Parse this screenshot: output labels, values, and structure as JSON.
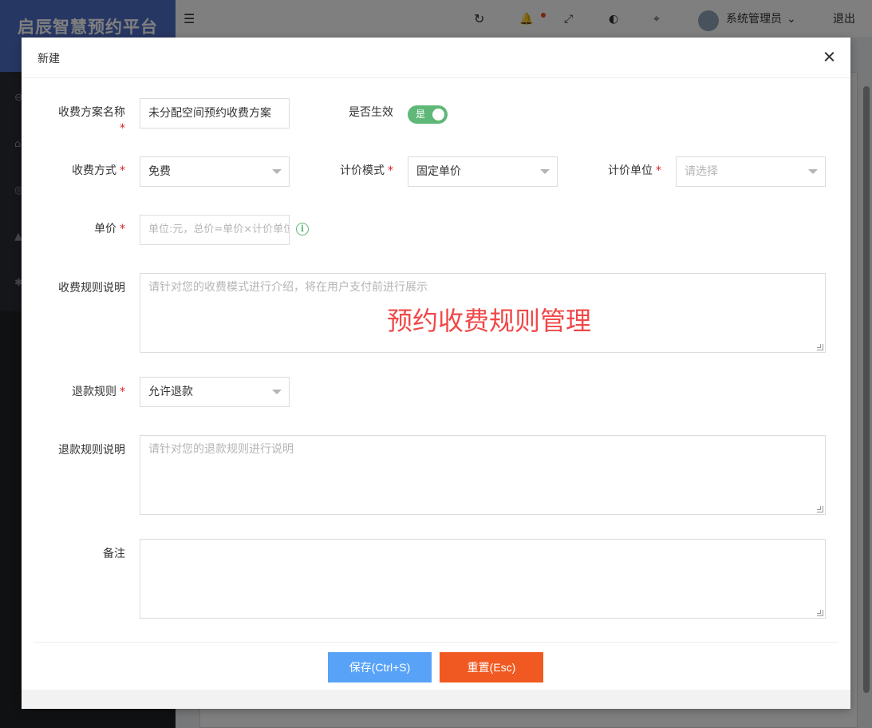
{
  "app": {
    "brand": "启辰智慧预约平台",
    "user_name": "系统管理员",
    "logout_label": "退出"
  },
  "modal": {
    "title": "新建",
    "fields": {
      "plan_name": {
        "label": "收费方案名称",
        "required_mark": "*",
        "value": "未分配空间预约收费方案"
      },
      "effective": {
        "label": "是否生效",
        "switch_text": "是"
      },
      "charge_method": {
        "label": "收费方式",
        "required_mark": "*",
        "value": "免费"
      },
      "pricing_mode": {
        "label": "计价模式",
        "required_mark": "*",
        "value": "固定单价"
      },
      "pricing_unit": {
        "label": "计价单位",
        "required_mark": "*",
        "placeholder": "请选择"
      },
      "unit_price": {
        "label": "单价",
        "required_mark": "*",
        "placeholder": "单位:元，总价=单价×计价单位"
      },
      "charge_rules": {
        "label": "收费规则说明",
        "placeholder": "请针对您的收费模式进行介绍，将在用户支付前进行展示"
      },
      "refund_rule": {
        "label": "退款规则",
        "required_mark": "*",
        "value": "允许退款"
      },
      "refund_rules_desc": {
        "label": "退款规则说明",
        "placeholder": "请针对您的退款规则进行说明"
      },
      "remark": {
        "label": "备注"
      }
    },
    "watermark": "预约收费规则管理",
    "save_label": "保存(Ctrl+S)",
    "reset_label": "重置(Esc)"
  },
  "colors": {
    "brand": "#4f6fc9",
    "switch_on": "#5fb878",
    "save_button": "#58a3f7",
    "reset_button": "#f05a22",
    "required": "#e02020",
    "watermark": "#f04848"
  }
}
